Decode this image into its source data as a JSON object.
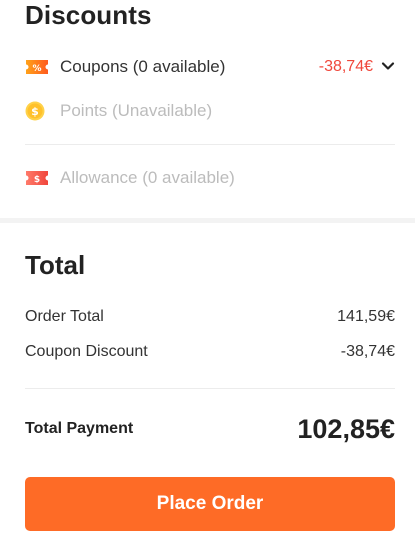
{
  "discounts": {
    "title": "Discounts",
    "coupons": {
      "label": "Coupons (0 available)",
      "amount": "-38,74€",
      "icon": "coupon-percent-icon",
      "icon_color": "#ff6a1a"
    },
    "points": {
      "label": "Points (Unavailable)",
      "icon": "coin-dollar-icon",
      "icon_color": "#ffc83d"
    },
    "allowance": {
      "label": "Allowance (0 available)",
      "icon": "allowance-ticket-icon",
      "icon_color": "#f4564a"
    }
  },
  "total": {
    "title": "Total",
    "order_total_label": "Order Total",
    "order_total_value": "141,59€",
    "coupon_discount_label": "Coupon Discount",
    "coupon_discount_value": "-38,74€",
    "payment_label": "Total Payment",
    "payment_value": "102,85€"
  },
  "place_order_label": "Place Order",
  "colors": {
    "accent": "#fe6b26",
    "discount_red": "#f0473b",
    "disabled_text": "#bcbcbc"
  }
}
